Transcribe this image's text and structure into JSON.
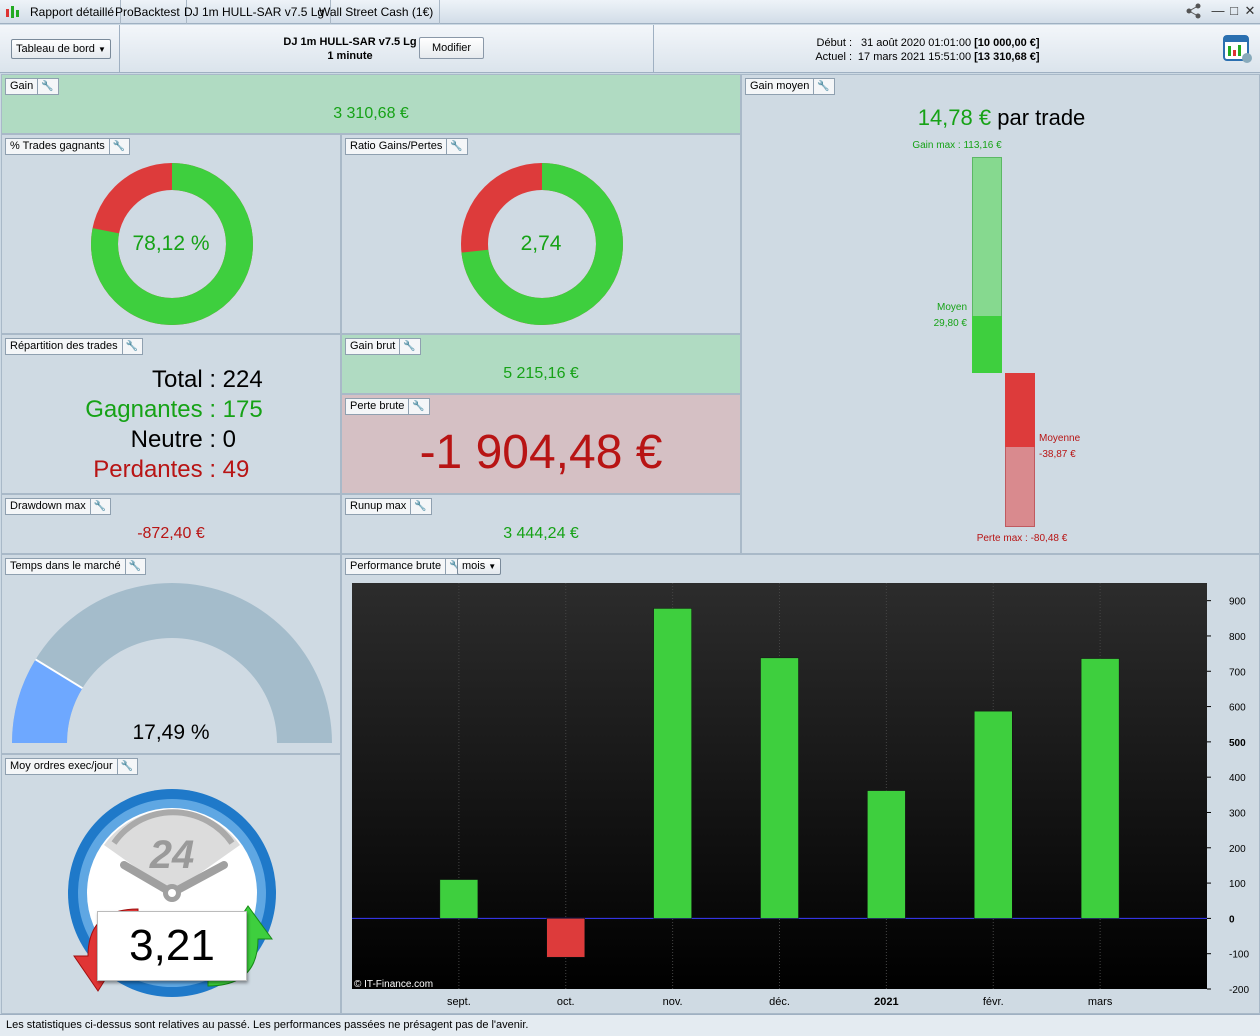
{
  "titlebar": {
    "tabs": [
      "Rapport détaillé",
      "ProBacktest",
      "DJ 1m HULL-SAR v7.5 Lg",
      "Wall Street Cash (1€)"
    ]
  },
  "header": {
    "view_select": "Tableau de bord",
    "strategy_name": "DJ 1m HULL-SAR v7.5 Lg",
    "timeframe": "1 minute",
    "modify_button": "Modifier",
    "start_label": "Début :",
    "start_date": "31 août 2020 01:01:00",
    "start_capital": "[10 000,00 €]",
    "current_label": "Actuel :",
    "current_date": "17 mars 2021 15:51:00",
    "current_capital": "[13 310,68 €]"
  },
  "gain": {
    "title": "Gain",
    "value": "3 310,68 €"
  },
  "winning_trades": {
    "title": "% Trades gagnants",
    "value": "78,12 %",
    "fraction": 0.7812
  },
  "ratio": {
    "title": "Ratio Gains/Pertes",
    "value": "2,74",
    "fraction": 0.7326
  },
  "distribution": {
    "title": "Répartition des trades",
    "total_label": "Total :",
    "total": "224",
    "winning_label": "Gagnantes :",
    "winning": "175",
    "neutral_label": "Neutre :",
    "neutral": "0",
    "losing_label": "Perdantes :",
    "losing": "49"
  },
  "gross_gain": {
    "title": "Gain brut",
    "value": "5 215,16 €"
  },
  "gross_loss": {
    "title": "Perte brute",
    "value": "-1 904,48 €"
  },
  "drawdown": {
    "title": "Drawdown max",
    "value": "-872,40 €"
  },
  "runup": {
    "title": "Runup max",
    "value": "3 444,24 €"
  },
  "avg_gain": {
    "title": "Gain moyen",
    "value": "14,78 €",
    "suffix": "par trade",
    "max_gain_label": "Gain max : 113,16 €",
    "avg_win_label": "Moyen",
    "avg_win_value": "29,80 €",
    "avg_loss_label": "Moyenne",
    "avg_loss_value": "-38,87 €",
    "max_loss_label": "Perte max : -80,48 €",
    "max_gain": 113.16,
    "avg_win": 29.8,
    "avg_loss": -38.87,
    "max_loss": -80.48
  },
  "time_in_market": {
    "title": "Temps dans le marché",
    "value": "17,49 %",
    "fraction": 0.1749
  },
  "orders_per_day": {
    "title": "Moy ordres exec/jour",
    "value": "3,21",
    "clock_label": "24"
  },
  "performance": {
    "title": "Performance brute",
    "period_select": "mois",
    "watermark": "© IT-Finance.com"
  },
  "chart_data": {
    "type": "bar",
    "categories": [
      "sept.",
      "oct.",
      "nov.",
      "déc.",
      "2021",
      "févr.",
      "mars"
    ],
    "values": [
      110,
      -110,
      878,
      738,
      362,
      587,
      736
    ],
    "ylim": [
      -200,
      950
    ],
    "yticks": [
      -200,
      -100,
      0,
      100,
      200,
      300,
      400,
      500,
      600,
      700,
      800,
      900
    ],
    "grid": true
  },
  "status": {
    "text": "Les statistiques ci-dessus sont relatives au passé. Les performances passées ne présagent pas de l'avenir."
  },
  "colors": {
    "green": "#3ecf3e",
    "red": "#dd3b3b",
    "gray_gauge": "#a4bccb",
    "blue_gauge": "#6ea8ff"
  }
}
